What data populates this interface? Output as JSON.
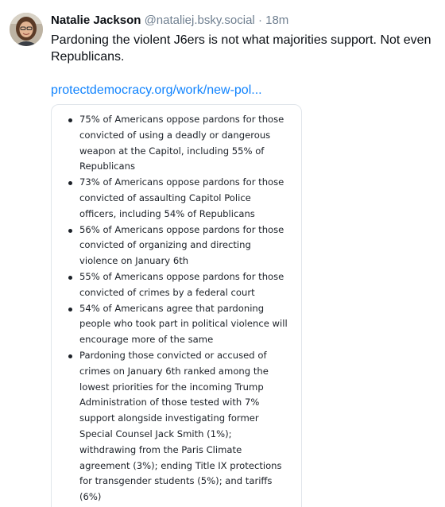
{
  "author": {
    "display_name": "Natalie Jackson",
    "handle": "@nataliej.bsky.social",
    "separator": "·",
    "time": "18m"
  },
  "post": {
    "text": "Pardoning the violent J6ers is not what majorities support. Not even Republicans.",
    "link_text": "protectdemocracy.org/work/new-pol..."
  },
  "card": {
    "bullets": [
      "75% of Americans oppose pardons for those convicted of using a deadly or dangerous weapon at the Capitol, including 55% of Republicans",
      "73% of Americans oppose pardons for those convicted of assaulting Capitol Police officers, including 54% of Republicans",
      "56% of Americans oppose pardons for those convicted of organizing and directing violence on January 6th",
      "55% of Americans oppose pardons for those convicted of crimes by a federal court",
      "54% of Americans agree that pardoning people who took part in political violence will encourage more of the same",
      "Pardoning those convicted or accused of crimes on January 6th ranked among the lowest priorities for the incoming Trump Administration of those tested with 7% support alongside investigating former Special Counsel Jack Smith (1%); withdrawing from the Paris Climate agreement (3%); ending Title IX protections for transgender students (5%); and tariffs (6%)"
    ]
  },
  "colors": {
    "link": "#1083fe",
    "muted": "#6f7f90",
    "text": "#0b0f14",
    "border": "#e1e6eb"
  },
  "icons": {
    "avatar": "avatar-photo"
  }
}
